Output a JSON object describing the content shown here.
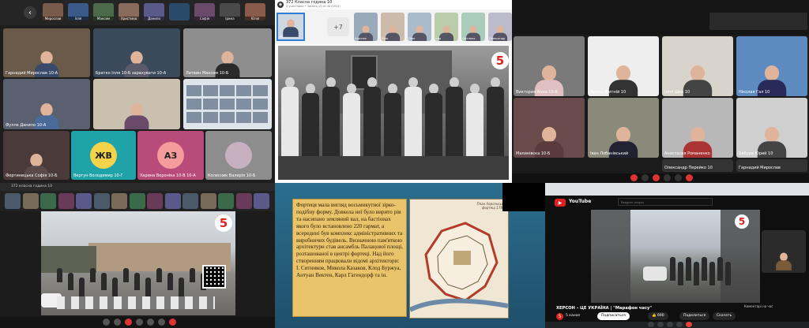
{
  "top_left": {
    "thumbs": [
      "Мирослав",
      "Ілля",
      "Максим",
      "Христина",
      "Данило",
      "",
      "Софія",
      "Ірина",
      "Юлія"
    ],
    "tiles": [
      {
        "label": "Гарнадий Мирослав 10-А"
      },
      {
        "label": "Братко Ілля 10-Б зарахувати 10-А"
      },
      {
        "label": "Литвин Максим 10-Б"
      },
      {
        "label": "Фулле Данило 10-А"
      },
      {
        "label": ""
      },
      {
        "label": ""
      },
      {
        "label": "Фертинецька Софія 10-Б"
      },
      {
        "label": "Вергун Володимир 10-Г"
      },
      {
        "label": "Харина Вероніка 10-В 10-А"
      },
      {
        "label": "Колесник Валерія 10-Б"
      }
    ],
    "avatars": [
      "ЖВ",
      "АЗ"
    ]
  },
  "top_middle": {
    "title": "372 Класна година 10",
    "subtitle": "4 участники • Запись 13 из 30 (2022)",
    "thumbs": [
      "Учасник",
      "Ніна",
      "Олег",
      "Ігор",
      "Світлана",
      "Олександр"
    ],
    "badge": "+7",
    "self_label": "Ні..."
  },
  "top_right": {
    "tiles": [
      {
        "label": "Виктория Анна 10-Б"
      },
      {
        "label": "Арина Житній 10"
      },
      {
        "label": "Ілля Щер 10"
      },
      {
        "label": "Ніколая Гал 10"
      },
      {
        "label": "Малинівска 10-Б"
      },
      {
        "label": "Іван Лобанівський"
      },
      {
        "label": "Анастасия Романенко"
      },
      {
        "label": "Бабура Юрий 10"
      },
      {
        "label": "Олександр Перейко 10"
      },
      {
        "label": "Гарнадий Мирослав"
      }
    ]
  },
  "bottom_left": {
    "title": "372 класна година 10",
    "live_badge": "5"
  },
  "bottom_middle": {
    "text": "Фортеця мала вигляд восьмикутної зірко-подібну форму. Довкола неї було вирито рів та насипано земляний вал, на бастіонах якого було встановлено 220 гармат, а всередині був комплекс адміністративних та виробничих будівель. Визначною пам'яткою архітектури став ансамбль Палацової площі, розташованої в центрі фортеці. Над його створенням працювали відомі архітектори: І. Ситников, Микола Казаков, Клод Буржуа, Антуан Вектен, Карл Гагендорф та ін.",
    "map_caption": "План Херсонської фортеці 1788р"
  },
  "bottom_right": {
    "brand": "YouTube",
    "search_placeholder": "Введите запрос",
    "video_title": "ХЕРСОН – ЦЕ УКРАЇНА | \"Марафон часу\"",
    "channel": "5 канал",
    "subscribe": "Подписаться",
    "likes": "690",
    "share": "Поделиться",
    "download": "Скачать",
    "participant": "Коментарі на час"
  }
}
